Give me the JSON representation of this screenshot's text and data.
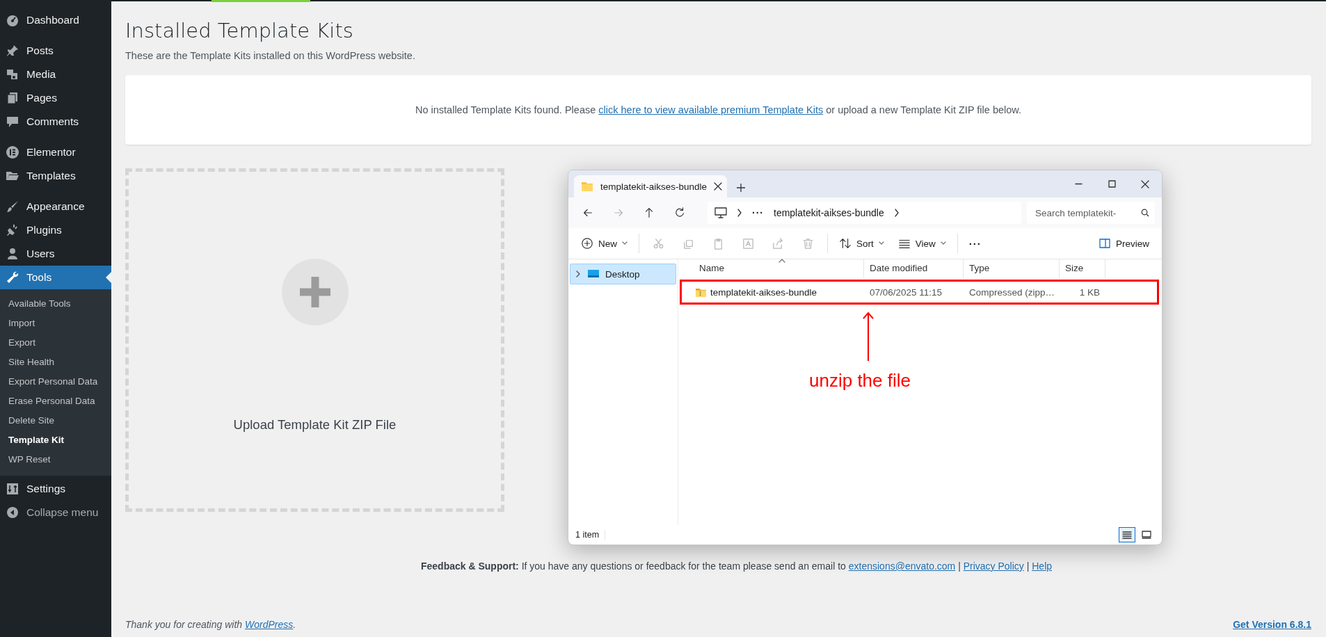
{
  "sidebar": {
    "groups": [
      {
        "items": [
          {
            "label": "Dashboard",
            "selected": false
          }
        ]
      },
      {
        "items": [
          {
            "label": "Posts",
            "selected": false
          },
          {
            "label": "Media",
            "selected": false
          },
          {
            "label": "Pages",
            "selected": false
          },
          {
            "label": "Comments",
            "selected": false
          }
        ]
      },
      {
        "items": [
          {
            "label": "Elementor",
            "selected": false
          },
          {
            "label": "Templates",
            "selected": false
          }
        ]
      },
      {
        "items": [
          {
            "label": "Appearance",
            "selected": false
          },
          {
            "label": "Plugins",
            "selected": false
          },
          {
            "label": "Users",
            "selected": false
          },
          {
            "label": "Tools",
            "selected": true,
            "children": [
              {
                "label": "Available Tools",
                "selected": false
              },
              {
                "label": "Import",
                "selected": false
              },
              {
                "label": "Export",
                "selected": false
              },
              {
                "label": "Site Health",
                "selected": false
              },
              {
                "label": "Export Personal Data",
                "selected": false
              },
              {
                "label": "Erase Personal Data",
                "selected": false
              },
              {
                "label": "Delete Site",
                "selected": false
              },
              {
                "label": "Template Kit",
                "selected": true
              },
              {
                "label": "WP Reset",
                "selected": false
              }
            ]
          },
          {
            "label": "Settings",
            "selected": false
          },
          {
            "label": "Collapse menu",
            "selected": false
          }
        ]
      }
    ]
  },
  "page": {
    "title": "Installed Template Kits",
    "subtitle": "These are the Template Kits installed on this WordPress website.",
    "notice": {
      "before": "No installed Template Kits found. Please",
      "link": "click here to view available premium Template Kits",
      "after": "or upload a new Template Kit ZIP file below."
    },
    "upload": {
      "label": "Upload Template Kit ZIP File"
    },
    "feedback": {
      "label": "Feedback & Support:",
      "text": "If you have any questions or feedback for the team please send an email to",
      "separator": "|",
      "links": [
        "extensions@envato.com",
        "Privacy Policy",
        "Help"
      ]
    },
    "footer": {
      "credit": "Thank you for creating with",
      "credit_link": "WordPress",
      "credit_end": ".",
      "version_link": "Get Version 6.8.1"
    }
  },
  "explorer": {
    "tab": {
      "title": "templatekit-aikses-bundle"
    },
    "nav_buttons": [
      {
        "disabled": false
      },
      {
        "disabled": true
      },
      {
        "disabled": false
      },
      {
        "disabled": false
      }
    ],
    "address": {
      "overflow": "···",
      "crumb": "templatekit-aikses-bundle"
    },
    "search": {
      "placeholder": "Search templatekit-"
    },
    "toolbar": {
      "new_label": "New",
      "icon_actions": [
        {
          "disabled": true
        },
        {
          "disabled": true
        },
        {
          "disabled": true
        },
        {
          "disabled": true
        },
        {
          "disabled": true
        },
        {
          "disabled": true
        }
      ],
      "sort_label": "Sort",
      "view_label": "View",
      "more": "···",
      "preview_label": "Preview"
    },
    "nav_pane": [
      {
        "label": "Desktop",
        "selected": true,
        "expanded": false
      }
    ],
    "columns": [
      "Name",
      "Date modified",
      "Type",
      "Size"
    ],
    "rows": [
      {
        "name": "templatekit-aikses-bundle",
        "date": "07/06/2025 11:15",
        "type": "Compressed (zipp…",
        "size": "1 KB",
        "outlined": true
      }
    ],
    "annotation": {
      "text": "unzip the file"
    },
    "status": "1 item",
    "view_toggles": [
      {
        "selected": true
      },
      {
        "selected": false
      }
    ]
  }
}
